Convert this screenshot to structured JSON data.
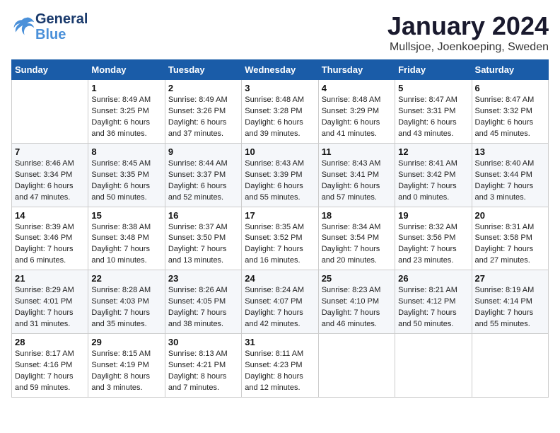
{
  "header": {
    "logo_line1": "General",
    "logo_line2": "Blue",
    "month_title": "January 2024",
    "subtitle": "Mullsjoe, Joenkoeping, Sweden"
  },
  "weekdays": [
    "Sunday",
    "Monday",
    "Tuesday",
    "Wednesday",
    "Thursday",
    "Friday",
    "Saturday"
  ],
  "weeks": [
    [
      {
        "day": "",
        "sunrise": "",
        "sunset": "",
        "daylight": ""
      },
      {
        "day": "1",
        "sunrise": "Sunrise: 8:49 AM",
        "sunset": "Sunset: 3:25 PM",
        "daylight": "Daylight: 6 hours and 36 minutes."
      },
      {
        "day": "2",
        "sunrise": "Sunrise: 8:49 AM",
        "sunset": "Sunset: 3:26 PM",
        "daylight": "Daylight: 6 hours and 37 minutes."
      },
      {
        "day": "3",
        "sunrise": "Sunrise: 8:48 AM",
        "sunset": "Sunset: 3:28 PM",
        "daylight": "Daylight: 6 hours and 39 minutes."
      },
      {
        "day": "4",
        "sunrise": "Sunrise: 8:48 AM",
        "sunset": "Sunset: 3:29 PM",
        "daylight": "Daylight: 6 hours and 41 minutes."
      },
      {
        "day": "5",
        "sunrise": "Sunrise: 8:47 AM",
        "sunset": "Sunset: 3:31 PM",
        "daylight": "Daylight: 6 hours and 43 minutes."
      },
      {
        "day": "6",
        "sunrise": "Sunrise: 8:47 AM",
        "sunset": "Sunset: 3:32 PM",
        "daylight": "Daylight: 6 hours and 45 minutes."
      }
    ],
    [
      {
        "day": "7",
        "sunrise": "Sunrise: 8:46 AM",
        "sunset": "Sunset: 3:34 PM",
        "daylight": "Daylight: 6 hours and 47 minutes."
      },
      {
        "day": "8",
        "sunrise": "Sunrise: 8:45 AM",
        "sunset": "Sunset: 3:35 PM",
        "daylight": "Daylight: 6 hours and 50 minutes."
      },
      {
        "day": "9",
        "sunrise": "Sunrise: 8:44 AM",
        "sunset": "Sunset: 3:37 PM",
        "daylight": "Daylight: 6 hours and 52 minutes."
      },
      {
        "day": "10",
        "sunrise": "Sunrise: 8:43 AM",
        "sunset": "Sunset: 3:39 PM",
        "daylight": "Daylight: 6 hours and 55 minutes."
      },
      {
        "day": "11",
        "sunrise": "Sunrise: 8:43 AM",
        "sunset": "Sunset: 3:41 PM",
        "daylight": "Daylight: 6 hours and 57 minutes."
      },
      {
        "day": "12",
        "sunrise": "Sunrise: 8:41 AM",
        "sunset": "Sunset: 3:42 PM",
        "daylight": "Daylight: 7 hours and 0 minutes."
      },
      {
        "day": "13",
        "sunrise": "Sunrise: 8:40 AM",
        "sunset": "Sunset: 3:44 PM",
        "daylight": "Daylight: 7 hours and 3 minutes."
      }
    ],
    [
      {
        "day": "14",
        "sunrise": "Sunrise: 8:39 AM",
        "sunset": "Sunset: 3:46 PM",
        "daylight": "Daylight: 7 hours and 6 minutes."
      },
      {
        "day": "15",
        "sunrise": "Sunrise: 8:38 AM",
        "sunset": "Sunset: 3:48 PM",
        "daylight": "Daylight: 7 hours and 10 minutes."
      },
      {
        "day": "16",
        "sunrise": "Sunrise: 8:37 AM",
        "sunset": "Sunset: 3:50 PM",
        "daylight": "Daylight: 7 hours and 13 minutes."
      },
      {
        "day": "17",
        "sunrise": "Sunrise: 8:35 AM",
        "sunset": "Sunset: 3:52 PM",
        "daylight": "Daylight: 7 hours and 16 minutes."
      },
      {
        "day": "18",
        "sunrise": "Sunrise: 8:34 AM",
        "sunset": "Sunset: 3:54 PM",
        "daylight": "Daylight: 7 hours and 20 minutes."
      },
      {
        "day": "19",
        "sunrise": "Sunrise: 8:32 AM",
        "sunset": "Sunset: 3:56 PM",
        "daylight": "Daylight: 7 hours and 23 minutes."
      },
      {
        "day": "20",
        "sunrise": "Sunrise: 8:31 AM",
        "sunset": "Sunset: 3:58 PM",
        "daylight": "Daylight: 7 hours and 27 minutes."
      }
    ],
    [
      {
        "day": "21",
        "sunrise": "Sunrise: 8:29 AM",
        "sunset": "Sunset: 4:01 PM",
        "daylight": "Daylight: 7 hours and 31 minutes."
      },
      {
        "day": "22",
        "sunrise": "Sunrise: 8:28 AM",
        "sunset": "Sunset: 4:03 PM",
        "daylight": "Daylight: 7 hours and 35 minutes."
      },
      {
        "day": "23",
        "sunrise": "Sunrise: 8:26 AM",
        "sunset": "Sunset: 4:05 PM",
        "daylight": "Daylight: 7 hours and 38 minutes."
      },
      {
        "day": "24",
        "sunrise": "Sunrise: 8:24 AM",
        "sunset": "Sunset: 4:07 PM",
        "daylight": "Daylight: 7 hours and 42 minutes."
      },
      {
        "day": "25",
        "sunrise": "Sunrise: 8:23 AM",
        "sunset": "Sunset: 4:10 PM",
        "daylight": "Daylight: 7 hours and 46 minutes."
      },
      {
        "day": "26",
        "sunrise": "Sunrise: 8:21 AM",
        "sunset": "Sunset: 4:12 PM",
        "daylight": "Daylight: 7 hours and 50 minutes."
      },
      {
        "day": "27",
        "sunrise": "Sunrise: 8:19 AM",
        "sunset": "Sunset: 4:14 PM",
        "daylight": "Daylight: 7 hours and 55 minutes."
      }
    ],
    [
      {
        "day": "28",
        "sunrise": "Sunrise: 8:17 AM",
        "sunset": "Sunset: 4:16 PM",
        "daylight": "Daylight: 7 hours and 59 minutes."
      },
      {
        "day": "29",
        "sunrise": "Sunrise: 8:15 AM",
        "sunset": "Sunset: 4:19 PM",
        "daylight": "Daylight: 8 hours and 3 minutes."
      },
      {
        "day": "30",
        "sunrise": "Sunrise: 8:13 AM",
        "sunset": "Sunset: 4:21 PM",
        "daylight": "Daylight: 8 hours and 7 minutes."
      },
      {
        "day": "31",
        "sunrise": "Sunrise: 8:11 AM",
        "sunset": "Sunset: 4:23 PM",
        "daylight": "Daylight: 8 hours and 12 minutes."
      },
      {
        "day": "",
        "sunrise": "",
        "sunset": "",
        "daylight": ""
      },
      {
        "day": "",
        "sunrise": "",
        "sunset": "",
        "daylight": ""
      },
      {
        "day": "",
        "sunrise": "",
        "sunset": "",
        "daylight": ""
      }
    ]
  ]
}
